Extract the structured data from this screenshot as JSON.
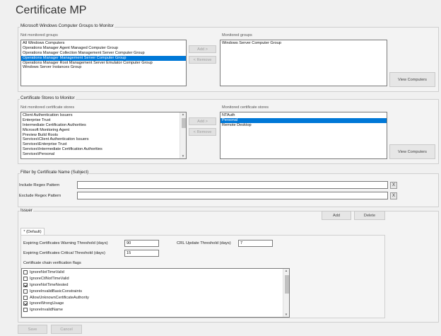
{
  "page_title": "Certificate MP",
  "computer_groups": {
    "title": "Microsoft Windows Computer Groups to Monitor",
    "not_monitored_label": "Not monitored groups",
    "monitored_label": "Monitored groups",
    "not_monitored_items": [
      "All Windows Computers",
      "Operations Manager Agent Managed Computer Group",
      "Operations Manager Collection Management Server Computer Group",
      "Operations Manager Management Server Computer Group",
      "Operations Manager Root Management Server Emulator Computer Group",
      "Windows Server Instances Group"
    ],
    "selected_index": 3,
    "monitored_items": [
      "Windows Server Computer Group"
    ],
    "add_label": "Add >",
    "remove_label": "< Remove",
    "view_label": "View Computers"
  },
  "cert_stores": {
    "title": "Certificate Stores to Monitor",
    "not_monitored_label": "Not monitored certificate stores",
    "monitored_label": "Monitored certificate stores",
    "not_monitored_items": [
      "Client Authentication Issuers",
      "Enterprise Trust",
      "Intermediate Certification Authorities",
      "Microsoft Monitoring Agent",
      "Preview Build Roots",
      "Services\\Client Authentication Issuers",
      "Services\\Enterprise Trust",
      "Services\\Intermediate Certification Authorities",
      "Services\\Personal"
    ],
    "monitored_items": [
      "NTAuth",
      "Personal",
      "Remote Desktop"
    ],
    "selected_index": 1,
    "add_label": "Add >",
    "remove_label": "< Remove",
    "view_label": "View Computers"
  },
  "filter": {
    "title": "Filter by Certificate Name (Subject)",
    "include_label": "Include Regex Pattern",
    "exclude_label": "Exclude Regex Pattern",
    "include_value": "",
    "exclude_value": "",
    "clear_label": "X"
  },
  "issuer": {
    "title": "Issuer",
    "add_label": "Add",
    "delete_label": "Delete",
    "tab_label": "* (Default)",
    "warning_label": "Expiring Certificates Warning Threshold (days)",
    "warning_value": "90",
    "critical_label": "Expiring Certificates Critical Threshold (days)",
    "critical_value": "15",
    "crl_label": "CRL Update Threshold (days)",
    "crl_value": "7",
    "flags_label": "Certificate chain verification flags",
    "flags": [
      {
        "label": "IgnoreNotTimeValid",
        "checked": false
      },
      {
        "label": "IgnoreCtlNotTimeValid",
        "checked": false
      },
      {
        "label": "IgnoreNotTimeNested",
        "checked": true
      },
      {
        "label": "IgnoreInvalidBasicConstraints",
        "checked": false
      },
      {
        "label": "AllowUnknownCertificateAuthority",
        "checked": false
      },
      {
        "label": "IgnoreWrongUsage",
        "checked": true
      },
      {
        "label": "IgnoreInvalidName",
        "checked": false
      }
    ]
  },
  "footer": {
    "save_label": "Save",
    "cancel_label": "Cancel"
  }
}
